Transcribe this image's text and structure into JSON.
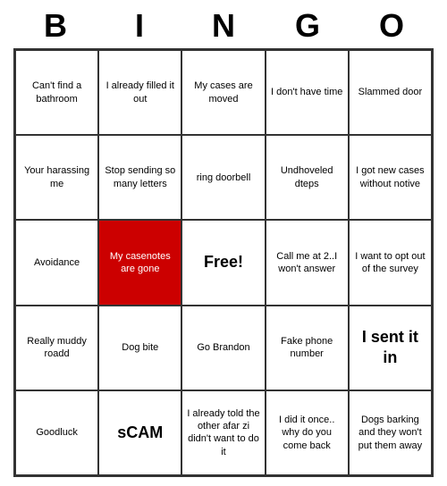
{
  "header": {
    "letters": [
      "B",
      "I",
      "N",
      "G",
      "O"
    ]
  },
  "cells": [
    {
      "text": "Can't find a bathroom",
      "highlighted": false,
      "large": false
    },
    {
      "text": "I already filled it out",
      "highlighted": false,
      "large": false
    },
    {
      "text": "My cases are moved",
      "highlighted": false,
      "large": false
    },
    {
      "text": "I don't have time",
      "highlighted": false,
      "large": false
    },
    {
      "text": "Slammed door",
      "highlighted": false,
      "large": false
    },
    {
      "text": "Your harassing me",
      "highlighted": false,
      "large": false
    },
    {
      "text": "Stop sending so many letters",
      "highlighted": false,
      "large": false
    },
    {
      "text": "ring doorbell",
      "highlighted": false,
      "large": false
    },
    {
      "text": "Undhoveled dteps",
      "highlighted": false,
      "large": false
    },
    {
      "text": "I got new cases without notive",
      "highlighted": false,
      "large": false
    },
    {
      "text": "Avoidance",
      "highlighted": false,
      "large": false
    },
    {
      "text": "My casenotes are gone",
      "highlighted": true,
      "large": false
    },
    {
      "text": "Free!",
      "highlighted": false,
      "large": true,
      "free": true
    },
    {
      "text": "Call me at 2..I won't answer",
      "highlighted": false,
      "large": false
    },
    {
      "text": "I want to opt out of the survey",
      "highlighted": false,
      "large": false
    },
    {
      "text": "Really muddy roadd",
      "highlighted": false,
      "large": false
    },
    {
      "text": "Dog bite",
      "highlighted": false,
      "large": false
    },
    {
      "text": "Go Brandon",
      "highlighted": false,
      "large": false
    },
    {
      "text": "Fake phone number",
      "highlighted": false,
      "large": false
    },
    {
      "text": "I sent it in",
      "highlighted": false,
      "large": true
    },
    {
      "text": "Goodluck",
      "highlighted": false,
      "large": false
    },
    {
      "text": "sCAM",
      "highlighted": false,
      "large": true
    },
    {
      "text": "I already told the other afar zi didn't want to do it",
      "highlighted": false,
      "large": false
    },
    {
      "text": "I did it once.. why do you come back",
      "highlighted": false,
      "large": false
    },
    {
      "text": "Dogs barking and they won't put them away",
      "highlighted": false,
      "large": false
    }
  ]
}
